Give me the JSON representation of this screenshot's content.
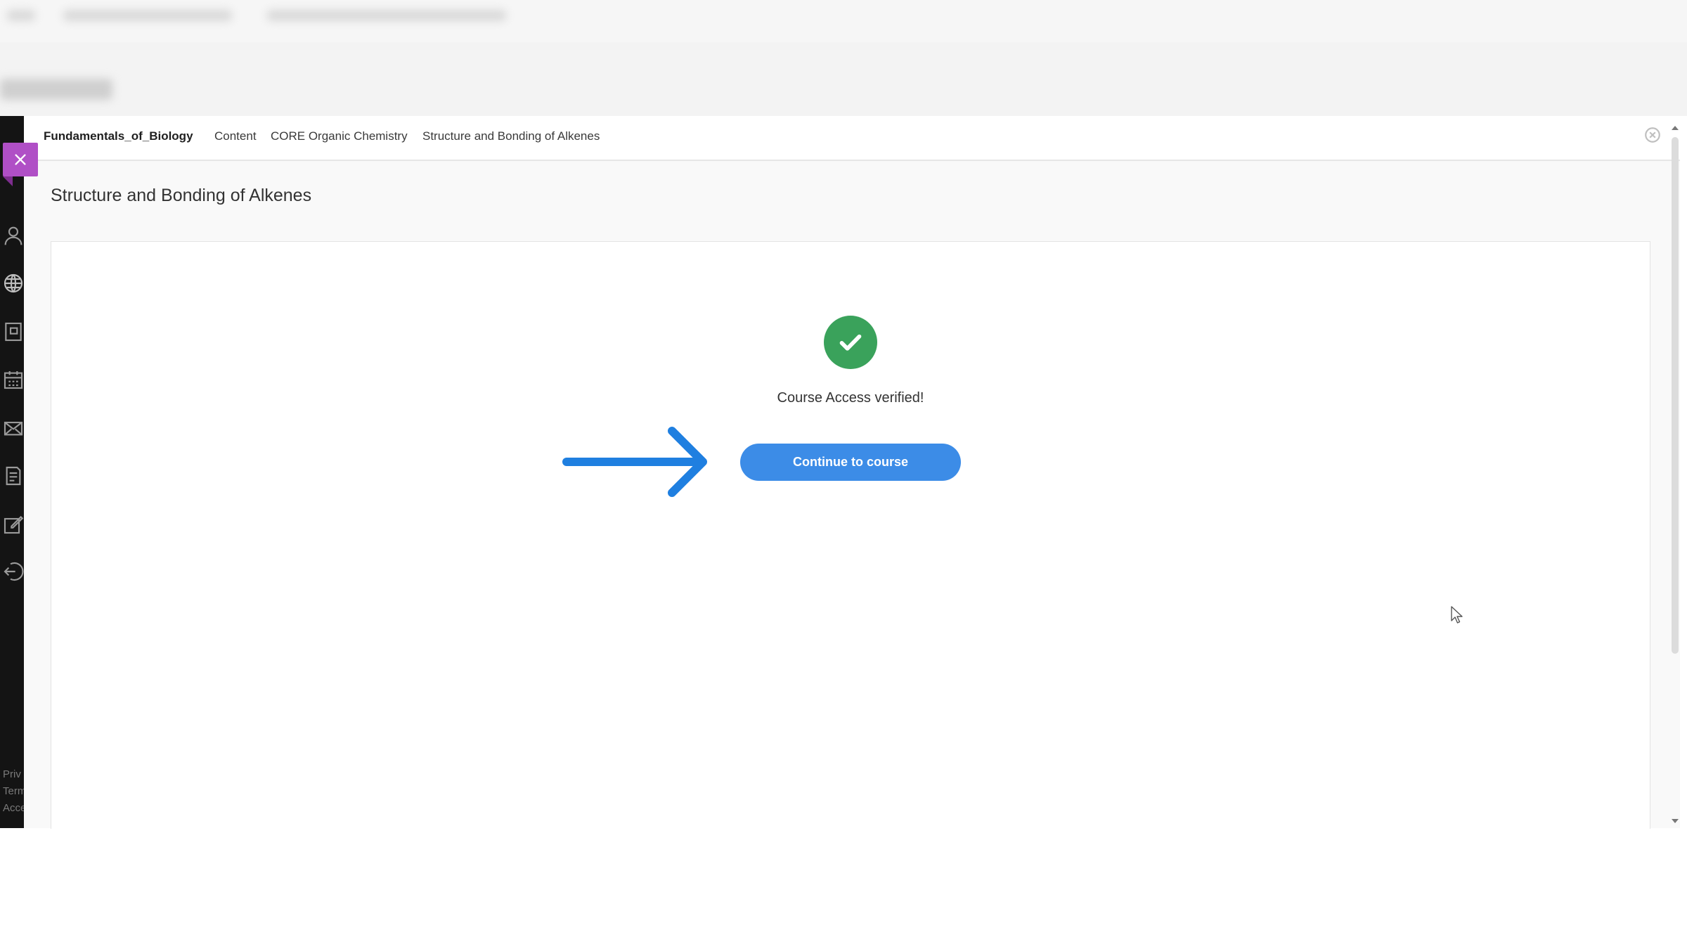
{
  "breadcrumb": {
    "course": "Fundamentals_of_Biology",
    "content": "Content",
    "module": "CORE Organic Chemistry",
    "page": "Structure and Bonding of Alkenes"
  },
  "page_title": "Structure and Bonding of Alkenes",
  "verification": {
    "message": "Course Access verified!",
    "button_label": "Continue to course"
  },
  "rail": {
    "icons": [
      "user-icon",
      "globe-icon",
      "book-icon",
      "calendar-icon",
      "mail-icon",
      "grades-icon",
      "edit-icon",
      "sign-out-icon"
    ],
    "footer": [
      "Priv",
      "Term",
      "Acce"
    ]
  },
  "colors": {
    "accent_purple": "#b04fc6",
    "success_green": "#3aa25b",
    "button_blue": "#3c8ce7",
    "arrow_blue": "#1f7fe0",
    "rail_dark": "#141414"
  }
}
